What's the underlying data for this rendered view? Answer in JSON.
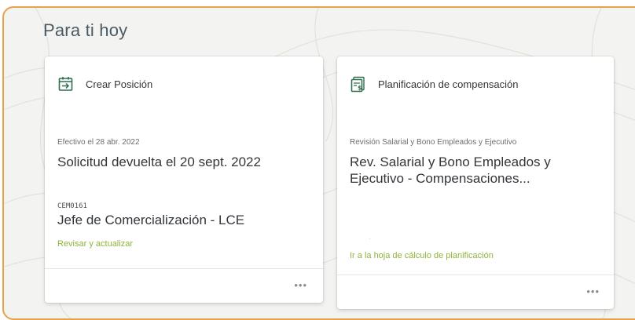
{
  "section": {
    "title": "Para ti hoy"
  },
  "cards": [
    {
      "header_title": "Crear Posición",
      "icon": "calendar-arrow-icon",
      "effective_label": "Efectivo el 28 abr. 2022",
      "main_text": "Solicitud devuelta el 20 sept. 2022",
      "code": "CEM0161",
      "position_title": "Jefe de Comercialización - LCE",
      "action_link": "Revisar y actualizar",
      "more": "•••"
    },
    {
      "header_title": "Planificación de compensación",
      "icon": "compensation-sheet-icon",
      "subtitle": "Revisión Salarial y Bono Empleados y Ejecutivo",
      "main_text": "Rev. Salarial y Bono Empleados y Ejecutivo - Compensaciones...",
      "dot": "·",
      "action_link": "Ir a la hoja de cálculo de planificación",
      "more": "•••"
    }
  ],
  "colors": {
    "frame_border": "#e8a24a",
    "icon_green": "#2f6f4f",
    "link_green": "#8fb33b"
  }
}
